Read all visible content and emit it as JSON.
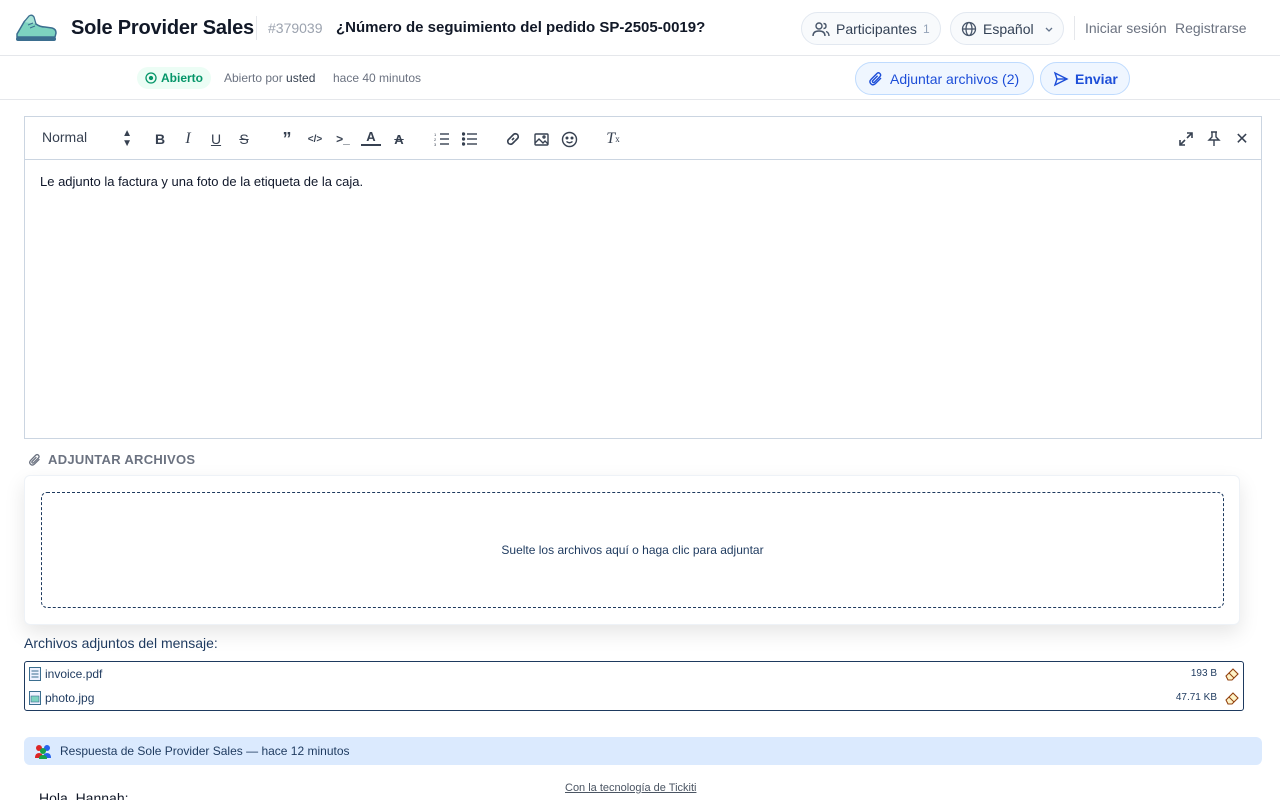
{
  "header": {
    "brand": "Sole Provider Sales",
    "ticket_id": "#379039",
    "ticket_title": "¿Número de seguimiento del pedido SP-2505-0019?",
    "participants_label": "Participantes",
    "participants_count": "1",
    "language_label": "Español",
    "login_label": "Iniciar sesión",
    "register_label": "Registrarse"
  },
  "status": {
    "badge": "Abierto",
    "opened_by_prefix": "Abierto por",
    "opened_by_user": "usted",
    "opened_time": "hace 40 minutos",
    "color": "#059669"
  },
  "actions": {
    "attach_label": "Adjuntar archivos (2)",
    "send_label": "Enviar"
  },
  "editor": {
    "heading_value": "Normal",
    "body_text": "Le adjunto la factura y una foto de la etiqueta de la caja."
  },
  "attachments": {
    "section_title": "ADJUNTAR ARCHIVOS",
    "dropzone_text": "Suelte los archivos aquí o haga clic para adjuntar",
    "files_label": "Archivos adjuntos del mensaje:",
    "files": [
      {
        "name": "invoice.pdf",
        "size": "193 B",
        "icon": "document-icon"
      },
      {
        "name": "photo.jpg",
        "size": "47.71 KB",
        "icon": "image-file-icon"
      }
    ]
  },
  "reply": {
    "header": "Respuesta de Sole Provider Sales — hace 12 minutos",
    "greeting": "Hola, Hannah:"
  },
  "footer": {
    "powered_by": "Con la tecnología de Tickiti"
  },
  "colors": {
    "accent": "#1d4ed8",
    "navy": "#1e3a5f",
    "reply_bg": "#dbeafe"
  }
}
